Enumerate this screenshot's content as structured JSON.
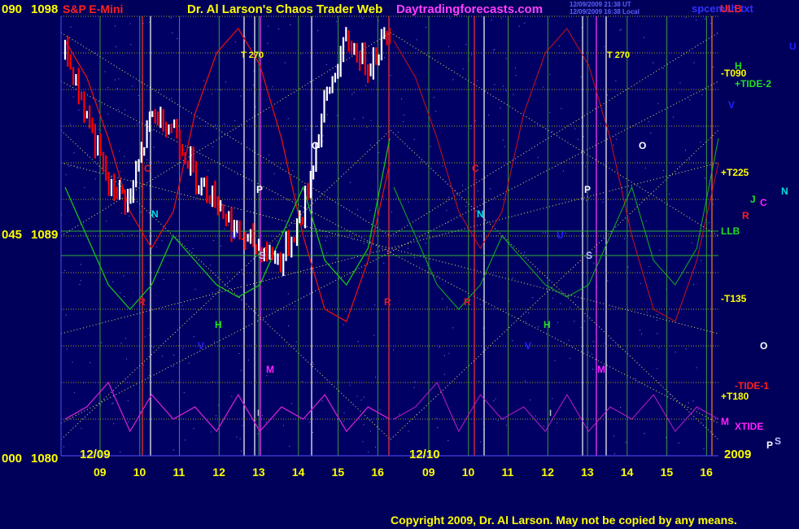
{
  "header": {
    "symbol": "S&P E-Mini",
    "title": "Dr. Al Larson's Chaos Trader Web",
    "site": "Daytradingforecasts.com",
    "timestamp_line1": "12/09/2009 21:38 UT",
    "timestamp_line2": "12/09/2009 16:38 Local",
    "file": "spcemsh.txt",
    "ulb": "ULB"
  },
  "y_axis": {
    "top": {
      "angle": "090",
      "price": "1098"
    },
    "middle": {
      "angle": "045",
      "price": "1089"
    },
    "bottom": {
      "angle": "000",
      "price": "1080"
    }
  },
  "x_axis": {
    "hours": [
      "09",
      "10",
      "11",
      "12",
      "13",
      "14",
      "15",
      "16",
      "09",
      "10",
      "11",
      "12",
      "13",
      "14",
      "15",
      "16"
    ],
    "date1": "12/09",
    "date2": "12/10",
    "year": "2009"
  },
  "right_labels": {
    "t090": "-T090",
    "h": "H",
    "tide2": "+TIDE-2",
    "v": "V",
    "t225": "+T225",
    "llb": "LLB",
    "t135": "-T135",
    "tide1": "-TIDE-1",
    "t180": "+T180",
    "xtide": "XTIDE",
    "m": "M",
    "u": "U",
    "n": "N",
    "j": "J",
    "c": "C",
    "r": "R",
    "o": "O",
    "p": "P",
    "s": "S"
  },
  "chart_labels": {
    "t270": "T  270",
    "c": "C",
    "n": "N",
    "r": "R",
    "h": "H",
    "m": "M",
    "o": "O",
    "p": "P",
    "s": "S",
    "u": "U",
    "v": "V",
    "i": "I"
  },
  "footer": {
    "copyright": "Copyright 2009, Dr. Al Larson. May not be copied by any means."
  },
  "colors": {
    "background": "#00005a",
    "price_up": "#ffffff",
    "price_down": "#ff0000",
    "red_line": "#e01010",
    "green_line": "#18c018",
    "magenta_line": "#d020d0",
    "yellow_dots": "#ffff60",
    "axis_yellow": "#ffff00"
  },
  "chart_data": {
    "type": "line",
    "title": "S&P E-Mini",
    "ylim": [
      1080,
      1098
    ],
    "x": [
      "12/09 08:30",
      "09:00",
      "09:30",
      "10:00",
      "10:30",
      "11:00",
      "11:30",
      "12:00",
      "12:30",
      "13:00",
      "13:30",
      "14:00",
      "14:30",
      "15:00",
      "15:30",
      "16:00"
    ],
    "series": [
      {
        "name": "S&P E-Mini",
        "values": [
          1096.5,
          1094.0,
          1091.0,
          1090.5,
          1094.0,
          1093.5,
          1091.5,
          1090.5,
          1089.0,
          1088.5,
          1088.0,
          1090.0,
          1094.5,
          1097.0,
          1096.0,
          1097.5
        ]
      },
      {
        "name": "TIDE-1",
        "values": [
          1097.0,
          1095.5,
          1093.0,
          1090.0,
          1088.5,
          1090.0,
          1094.0,
          1096.5,
          1097.5,
          1096.0,
          1093.0,
          1089.0,
          1086.0,
          1085.5,
          1088.0,
          1092.0
        ]
      },
      {
        "name": "TIDE-2",
        "values": [
          1091.0,
          1089.0,
          1087.0,
          1086.0,
          1087.0,
          1089.0,
          1088.0,
          1087.0,
          1086.5,
          1087.0,
          1089.0,
          1091.0,
          1088.0,
          1087.0,
          1088.5,
          1093.0
        ]
      },
      {
        "name": "XTIDE",
        "values": [
          1081.5,
          1082.0,
          1083.0,
          1081.0,
          1082.5,
          1081.5,
          1082.0,
          1081.0,
          1082.5,
          1081.0,
          1082.0,
          1081.5,
          1082.5,
          1081.0,
          1082.0,
          1081.5
        ]
      }
    ]
  }
}
